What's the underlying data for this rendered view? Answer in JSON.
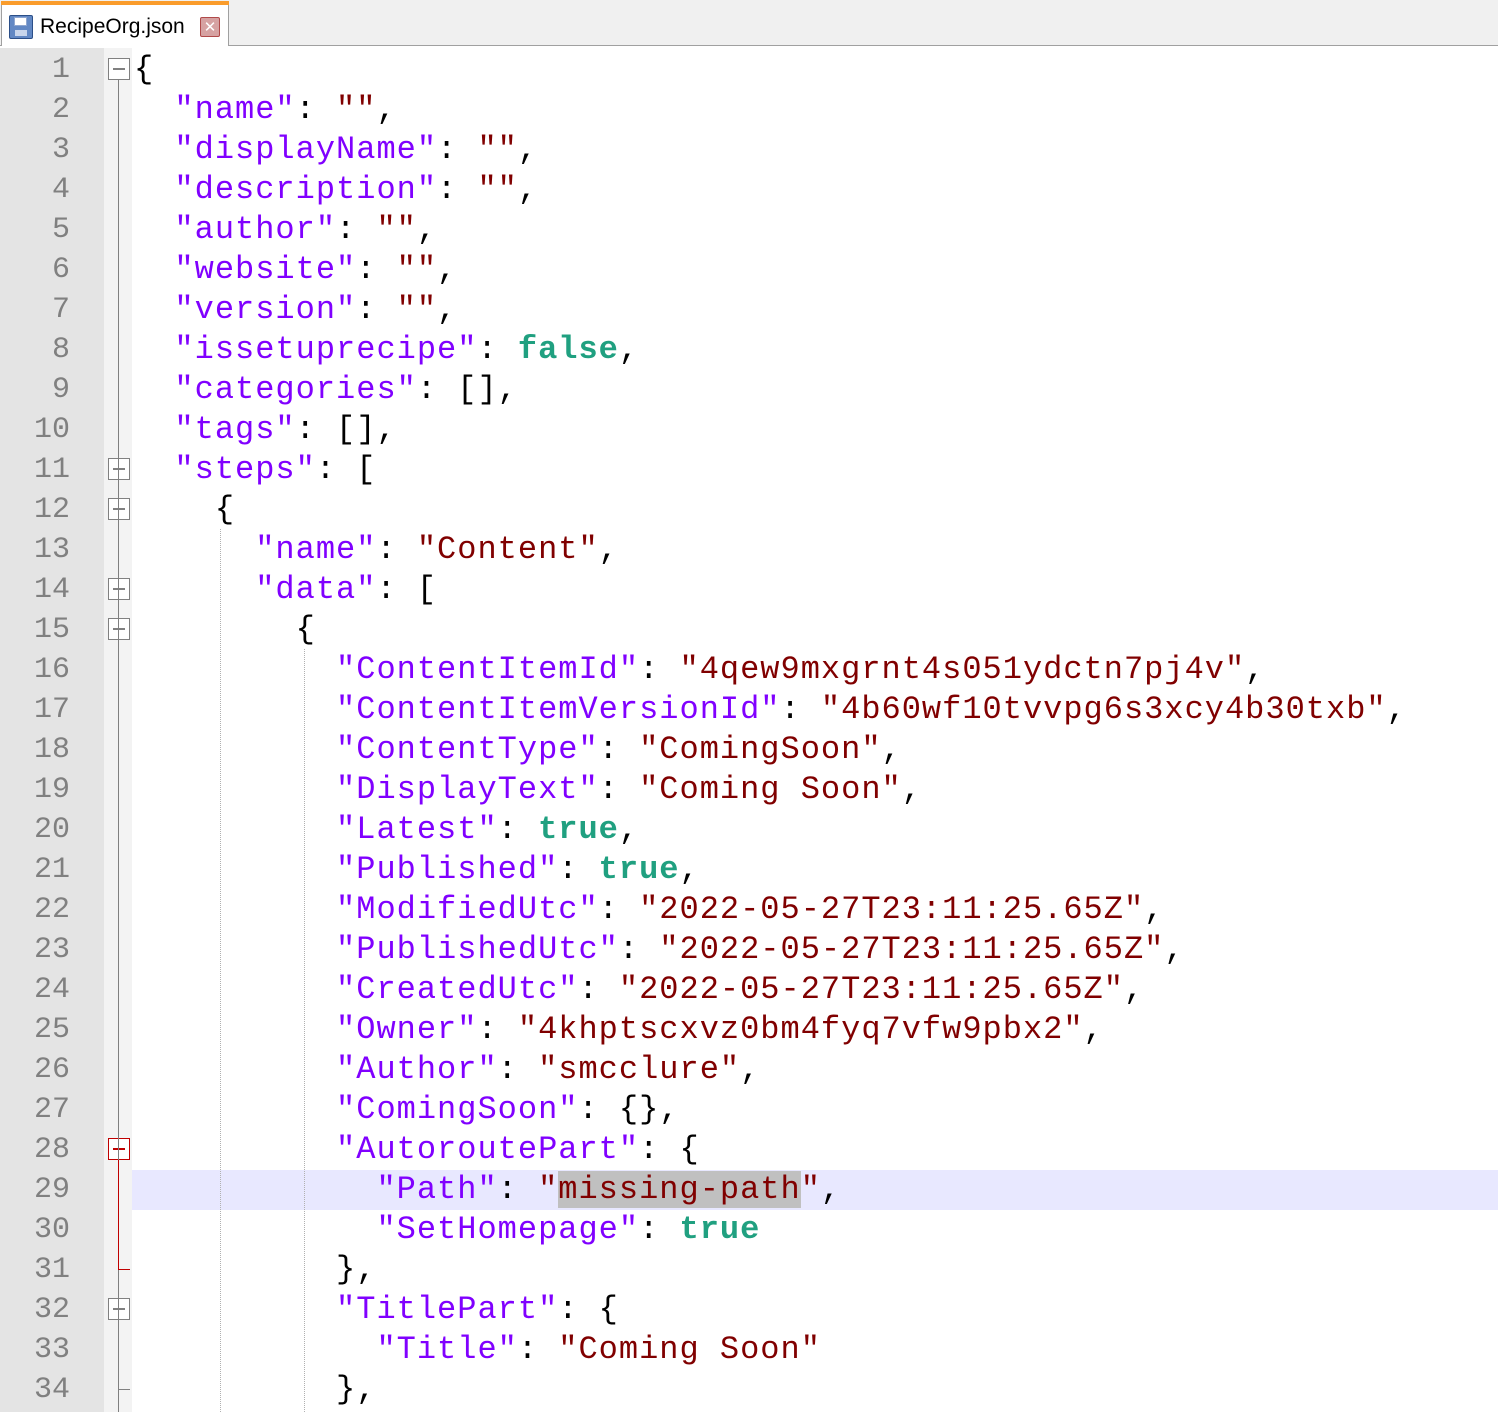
{
  "tab": {
    "file_name": "RecipeOrg.json",
    "file_icon": "floppy-save-icon",
    "close_icon": "close-x-icon"
  },
  "editor": {
    "current_line": 29,
    "selection": "missing-path",
    "lines": [
      {
        "n": "1",
        "tokens": [
          [
            "p",
            "{"
          ]
        ]
      },
      {
        "n": "2",
        "tokens": [
          [
            "p",
            "  "
          ],
          [
            "k",
            "\"name\""
          ],
          [
            "p",
            ": "
          ],
          [
            "s",
            "\"\""
          ],
          [
            "p",
            ","
          ]
        ]
      },
      {
        "n": "3",
        "tokens": [
          [
            "p",
            "  "
          ],
          [
            "k",
            "\"displayName\""
          ],
          [
            "p",
            ": "
          ],
          [
            "s",
            "\"\""
          ],
          [
            "p",
            ","
          ]
        ]
      },
      {
        "n": "4",
        "tokens": [
          [
            "p",
            "  "
          ],
          [
            "k",
            "\"description\""
          ],
          [
            "p",
            ": "
          ],
          [
            "s",
            "\"\""
          ],
          [
            "p",
            ","
          ]
        ]
      },
      {
        "n": "5",
        "tokens": [
          [
            "p",
            "  "
          ],
          [
            "k",
            "\"author\""
          ],
          [
            "p",
            ": "
          ],
          [
            "s",
            "\"\""
          ],
          [
            "p",
            ","
          ]
        ]
      },
      {
        "n": "6",
        "tokens": [
          [
            "p",
            "  "
          ],
          [
            "k",
            "\"website\""
          ],
          [
            "p",
            ": "
          ],
          [
            "s",
            "\"\""
          ],
          [
            "p",
            ","
          ]
        ]
      },
      {
        "n": "7",
        "tokens": [
          [
            "p",
            "  "
          ],
          [
            "k",
            "\"version\""
          ],
          [
            "p",
            ": "
          ],
          [
            "s",
            "\"\""
          ],
          [
            "p",
            ","
          ]
        ]
      },
      {
        "n": "8",
        "tokens": [
          [
            "p",
            "  "
          ],
          [
            "k",
            "\"issetuprecipe\""
          ],
          [
            "p",
            ": "
          ],
          [
            "b",
            "false"
          ],
          [
            "p",
            ","
          ]
        ]
      },
      {
        "n": "9",
        "tokens": [
          [
            "p",
            "  "
          ],
          [
            "k",
            "\"categories\""
          ],
          [
            "p",
            ": [],"
          ]
        ]
      },
      {
        "n": "10",
        "tokens": [
          [
            "p",
            "  "
          ],
          [
            "k",
            "\"tags\""
          ],
          [
            "p",
            ": [],"
          ]
        ]
      },
      {
        "n": "11",
        "tokens": [
          [
            "p",
            "  "
          ],
          [
            "k",
            "\"steps\""
          ],
          [
            "p",
            ": ["
          ]
        ]
      },
      {
        "n": "12",
        "tokens": [
          [
            "p",
            "    {"
          ]
        ]
      },
      {
        "n": "13",
        "tokens": [
          [
            "p",
            "      "
          ],
          [
            "k",
            "\"name\""
          ],
          [
            "p",
            ": "
          ],
          [
            "s",
            "\"Content\""
          ],
          [
            "p",
            ","
          ]
        ]
      },
      {
        "n": "14",
        "tokens": [
          [
            "p",
            "      "
          ],
          [
            "k",
            "\"data\""
          ],
          [
            "p",
            ": ["
          ]
        ]
      },
      {
        "n": "15",
        "tokens": [
          [
            "p",
            "        {"
          ]
        ]
      },
      {
        "n": "16",
        "tokens": [
          [
            "p",
            "          "
          ],
          [
            "k",
            "\"ContentItemId\""
          ],
          [
            "p",
            ": "
          ],
          [
            "s",
            "\"4qew9mxgrnt4s051ydctn7pj4v\""
          ],
          [
            "p",
            ","
          ]
        ]
      },
      {
        "n": "17",
        "tokens": [
          [
            "p",
            "          "
          ],
          [
            "k",
            "\"ContentItemVersionId\""
          ],
          [
            "p",
            ": "
          ],
          [
            "s",
            "\"4b60wf10tvvpg6s3xcy4b30txb\""
          ],
          [
            "p",
            ","
          ]
        ]
      },
      {
        "n": "18",
        "tokens": [
          [
            "p",
            "          "
          ],
          [
            "k",
            "\"ContentType\""
          ],
          [
            "p",
            ": "
          ],
          [
            "s",
            "\"ComingSoon\""
          ],
          [
            "p",
            ","
          ]
        ]
      },
      {
        "n": "19",
        "tokens": [
          [
            "p",
            "          "
          ],
          [
            "k",
            "\"DisplayText\""
          ],
          [
            "p",
            ": "
          ],
          [
            "s",
            "\"Coming Soon\""
          ],
          [
            "p",
            ","
          ]
        ]
      },
      {
        "n": "20",
        "tokens": [
          [
            "p",
            "          "
          ],
          [
            "k",
            "\"Latest\""
          ],
          [
            "p",
            ": "
          ],
          [
            "b",
            "true"
          ],
          [
            "p",
            ","
          ]
        ]
      },
      {
        "n": "21",
        "tokens": [
          [
            "p",
            "          "
          ],
          [
            "k",
            "\"Published\""
          ],
          [
            "p",
            ": "
          ],
          [
            "b",
            "true"
          ],
          [
            "p",
            ","
          ]
        ]
      },
      {
        "n": "22",
        "tokens": [
          [
            "p",
            "          "
          ],
          [
            "k",
            "\"ModifiedUtc\""
          ],
          [
            "p",
            ": "
          ],
          [
            "s",
            "\"2022-05-27T23:11:25.65Z\""
          ],
          [
            "p",
            ","
          ]
        ]
      },
      {
        "n": "23",
        "tokens": [
          [
            "p",
            "          "
          ],
          [
            "k",
            "\"PublishedUtc\""
          ],
          [
            "p",
            ": "
          ],
          [
            "s",
            "\"2022-05-27T23:11:25.65Z\""
          ],
          [
            "p",
            ","
          ]
        ]
      },
      {
        "n": "24",
        "tokens": [
          [
            "p",
            "          "
          ],
          [
            "k",
            "\"CreatedUtc\""
          ],
          [
            "p",
            ": "
          ],
          [
            "s",
            "\"2022-05-27T23:11:25.65Z\""
          ],
          [
            "p",
            ","
          ]
        ]
      },
      {
        "n": "25",
        "tokens": [
          [
            "p",
            "          "
          ],
          [
            "k",
            "\"Owner\""
          ],
          [
            "p",
            ": "
          ],
          [
            "s",
            "\"4khptscxvz0bm4fyq7vfw9pbx2\""
          ],
          [
            "p",
            ","
          ]
        ]
      },
      {
        "n": "26",
        "tokens": [
          [
            "p",
            "          "
          ],
          [
            "k",
            "\"Author\""
          ],
          [
            "p",
            ": "
          ],
          [
            "s",
            "\"smcclure\""
          ],
          [
            "p",
            ","
          ]
        ]
      },
      {
        "n": "27",
        "tokens": [
          [
            "p",
            "          "
          ],
          [
            "k",
            "\"ComingSoon\""
          ],
          [
            "p",
            ": {},"
          ]
        ]
      },
      {
        "n": "28",
        "tokens": [
          [
            "p",
            "          "
          ],
          [
            "k",
            "\"AutoroutePart\""
          ],
          [
            "p",
            ": {"
          ]
        ]
      },
      {
        "n": "29",
        "tokens": [
          [
            "p",
            "            "
          ],
          [
            "k",
            "\"Path\""
          ],
          [
            "p",
            ": "
          ],
          [
            "s",
            "\""
          ],
          [
            "sel",
            "missing-path"
          ],
          [
            "s",
            "\""
          ],
          [
            "p",
            ","
          ]
        ]
      },
      {
        "n": "30",
        "tokens": [
          [
            "p",
            "            "
          ],
          [
            "k",
            "\"SetHomepage\""
          ],
          [
            "p",
            ": "
          ],
          [
            "b",
            "true"
          ]
        ]
      },
      {
        "n": "31",
        "tokens": [
          [
            "p",
            "          },"
          ]
        ]
      },
      {
        "n": "32",
        "tokens": [
          [
            "p",
            "          "
          ],
          [
            "k",
            "\"TitlePart\""
          ],
          [
            "p",
            ": {"
          ]
        ]
      },
      {
        "n": "33",
        "tokens": [
          [
            "p",
            "            "
          ],
          [
            "k",
            "\"Title\""
          ],
          [
            "p",
            ": "
          ],
          [
            "s",
            "\"Coming Soon\""
          ]
        ]
      },
      {
        "n": "34",
        "tokens": [
          [
            "p",
            "          },"
          ]
        ]
      }
    ]
  }
}
